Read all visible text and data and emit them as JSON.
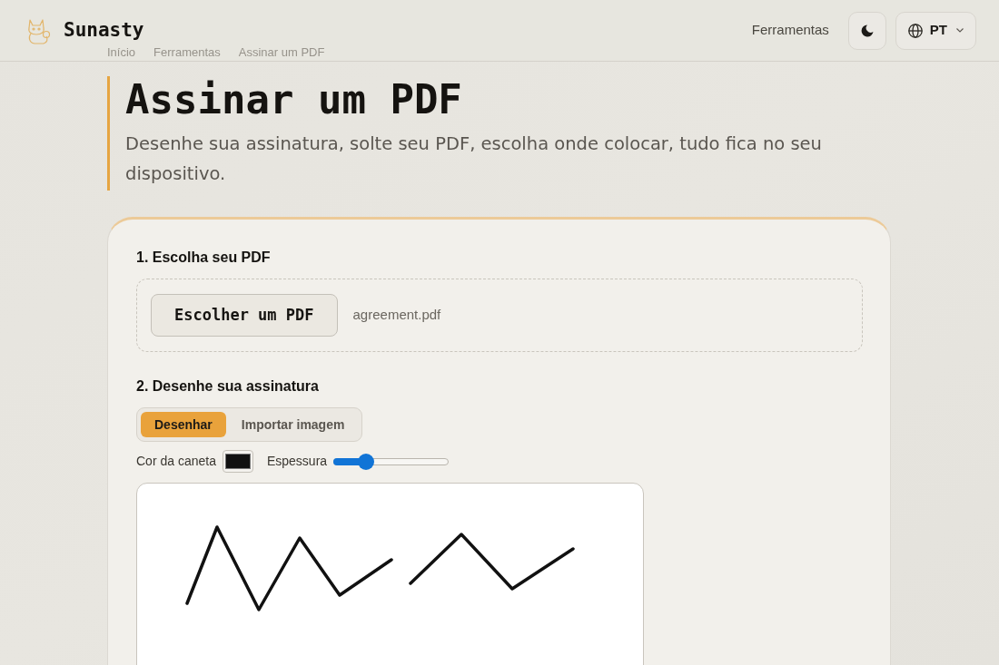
{
  "header": {
    "brand": "Sunasty",
    "nav_link": "Ferramentas",
    "language": "PT"
  },
  "breadcrumb": [
    "Início",
    "Ferramentas",
    "Assinar um PDF"
  ],
  "page": {
    "title": "Assinar um PDF",
    "subtitle": "Desenhe sua assinatura, solte seu PDF, escolha onde colocar, tudo fica no seu dispositivo."
  },
  "step_1": {
    "heading": "1. Escolha seu PDF",
    "button": "Escolher um PDF",
    "file_name": "agreement.pdf"
  },
  "step_2": {
    "heading": "2. Desenhe sua assinatura",
    "tabs": [
      {
        "label": "Desenhar",
        "selected": true
      },
      {
        "label": "Importar imagem",
        "selected": false
      }
    ],
    "pen_color": {
      "label": "Cor da caneta",
      "color": "#111111"
    },
    "thickness": {
      "label": "Espessura",
      "level": 0.25
    }
  }
}
